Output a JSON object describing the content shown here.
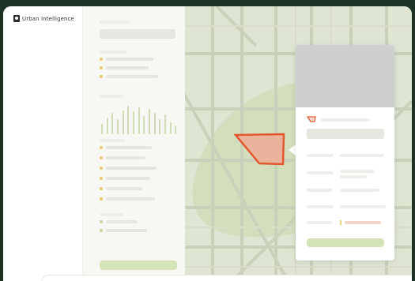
{
  "app": {
    "brand_name": "Urban Intelligence",
    "brand_logo_icon": "map-pin-logo-icon"
  },
  "colors": {
    "background": "#1d3125",
    "map_base": "#dfe5d3",
    "parcel_fill": "#e9b49b",
    "parcel_stroke": "#e2572c",
    "accent_green": "#d4e3b6",
    "accent_yellow": "#e8cf7a"
  },
  "filter_panel": {
    "histogram_levels": [
      0.35,
      0.55,
      0.7,
      0.5,
      0.8,
      0.95,
      0.75,
      0.9,
      0.6,
      0.85,
      0.7,
      0.5,
      0.65,
      0.4,
      0.3
    ]
  }
}
